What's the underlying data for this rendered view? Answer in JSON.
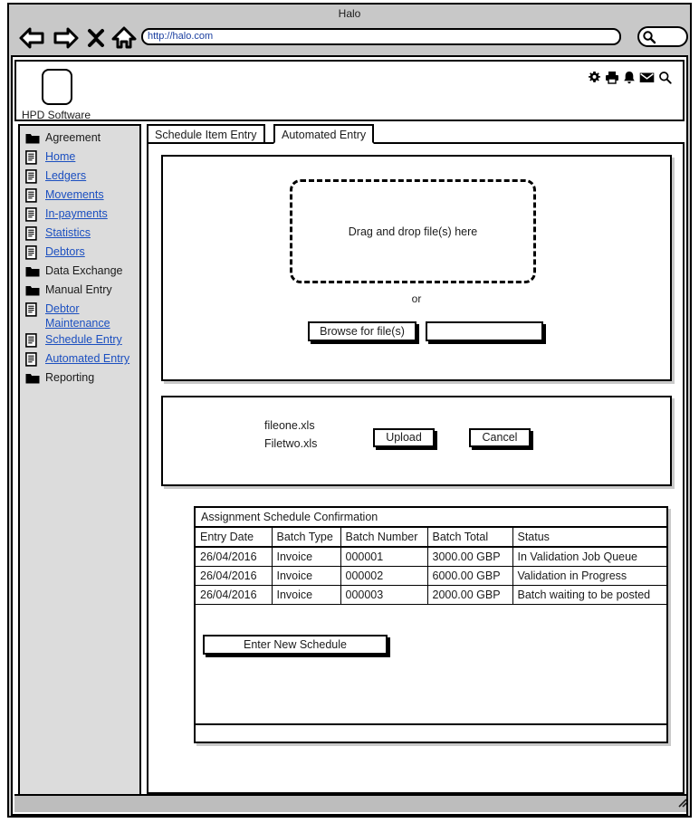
{
  "browser": {
    "title": "Halo",
    "url": "http://halo.com",
    "search_placeholder": "",
    "nav": {
      "back": "back-icon",
      "forward": "forward-icon",
      "stop": "close-icon",
      "home": "home-icon",
      "search": "search-icon"
    }
  },
  "app_header": {
    "logo_label": "HPD Software",
    "icons": [
      {
        "name": "gear-icon",
        "title": "Settings"
      },
      {
        "name": "printer-icon",
        "title": "Print"
      },
      {
        "name": "bell-icon",
        "title": "Notifications"
      },
      {
        "name": "envelope-icon",
        "title": "Messages"
      },
      {
        "name": "search-icon",
        "title": "Search"
      }
    ]
  },
  "sidebar": {
    "items": [
      {
        "label": "Agreement",
        "icon": "folder-icon",
        "link": false
      },
      {
        "label": "Home",
        "icon": "document-icon",
        "link": true
      },
      {
        "label": "Ledgers",
        "icon": "document-icon",
        "link": true
      },
      {
        "label": "Movements",
        "icon": "document-icon",
        "link": true
      },
      {
        "label": "In-payments",
        "icon": "document-icon",
        "link": true
      },
      {
        "label": "Statistics",
        "icon": "document-icon",
        "link": true
      },
      {
        "label": "Debtors",
        "icon": "document-icon",
        "link": true
      },
      {
        "label": "Data Exchange",
        "icon": "folder-icon",
        "link": false
      },
      {
        "label": "Manual Entry",
        "icon": "folder-icon",
        "link": false
      },
      {
        "label": "Debtor Maintenance",
        "icon": "document-icon",
        "link": true
      },
      {
        "label": "Schedule Entry",
        "icon": "document-icon",
        "link": true
      },
      {
        "label": "Automated Entry",
        "icon": "document-icon",
        "link": true
      },
      {
        "label": "Reporting",
        "icon": "folder-icon",
        "link": false
      }
    ]
  },
  "content": {
    "tabs": [
      {
        "label": "Schedule Item Entry",
        "active": false
      },
      {
        "label": "Automated Entry",
        "active": true
      }
    ],
    "upload": {
      "dropzone_text": "Drag and drop file(s) here",
      "or_label": "or",
      "browse_button": "Browse for file(s)",
      "path_value": "",
      "path_placeholder": ""
    },
    "files": {
      "names": [
        "fileone.xls",
        "Filetwo.xls"
      ],
      "upload_button": "Upload",
      "cancel_button": "Cancel"
    },
    "confirmation": {
      "caption": "Assignment Schedule Confirmation",
      "columns": [
        "Entry Date",
        "Batch Type",
        "Batch Number",
        "Batch Total",
        "Status"
      ],
      "rows": [
        [
          "26/04/2016",
          "Invoice",
          "000001",
          "3000.00 GBP",
          "In Validation Job Queue"
        ],
        [
          "26/04/2016",
          "Invoice",
          "000002",
          "6000.00 GBP",
          "Validation in Progress"
        ],
        [
          "26/04/2016",
          "Invoice",
          "000003",
          "2000.00 GBP",
          "Batch waiting to be posted"
        ]
      ],
      "new_schedule_button": "Enter New Schedule"
    }
  },
  "colors": {
    "chrome": "#c8c8c8",
    "sidebar": "#dcdcdc",
    "link": "#1b4fc0",
    "text": "#1b1b1b",
    "status_bar": "#bdbdbd"
  }
}
